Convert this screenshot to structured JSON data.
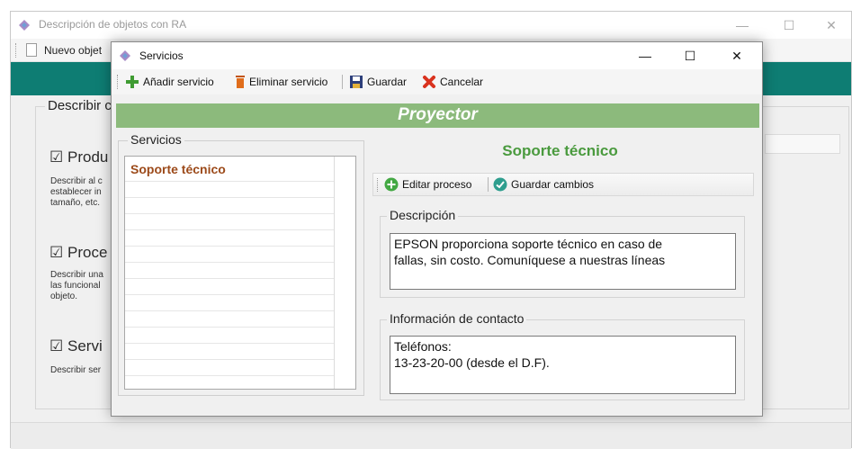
{
  "main_window": {
    "title": "Descripción de objetos con RA",
    "toolbar_new_label": "Nuevo objet",
    "group_label": "Describir c",
    "sections": [
      {
        "check": "☑",
        "label": "Produ",
        "desc": "Describir al c\nestablecer in\ntamaño, etc."
      },
      {
        "check": "☑",
        "label": "Proce",
        "desc": "Describir una\nlas funcional\nobjeto."
      },
      {
        "check": "☑",
        "label": "Servi",
        "desc": "Describir ser"
      }
    ]
  },
  "dialog": {
    "title": "Servicios",
    "toolbar": {
      "add_label": "Añadir servicio",
      "delete_label": "Eliminar servicio",
      "save_label": "Guardar",
      "cancel_label": "Cancelar"
    },
    "header": "Proyector",
    "services_group_label": "Servicios",
    "services": [
      "Soporte técnico"
    ],
    "detail": {
      "title": "Soporte técnico",
      "edit_label": "Editar proceso",
      "save_changes_label": "Guardar cambios",
      "description_label": "Descripción",
      "description_text": "EPSON proporciona soporte técnico en caso de\nfallas, sin costo. Comuníquese a nuestras líneas",
      "contact_label": "Información de contacto",
      "contact_text": "Teléfonos:\n13-23-20-00 (desde el D.F)."
    }
  },
  "window_buttons": {
    "minimize": "—",
    "maximize": "☐",
    "close": "✕"
  },
  "icons": {
    "app": "app-logo-icon",
    "add": "plus-icon",
    "delete": "trash-icon",
    "save": "floppy-disk-icon",
    "cancel": "x-icon",
    "edit": "plus-circle-icon",
    "save_changes": "check-circle-icon"
  },
  "colors": {
    "teal_band": "#0e7d73",
    "header_band": "#8cba7c",
    "detail_title": "#4a9a3e",
    "list_item": "#9c4a1a"
  }
}
